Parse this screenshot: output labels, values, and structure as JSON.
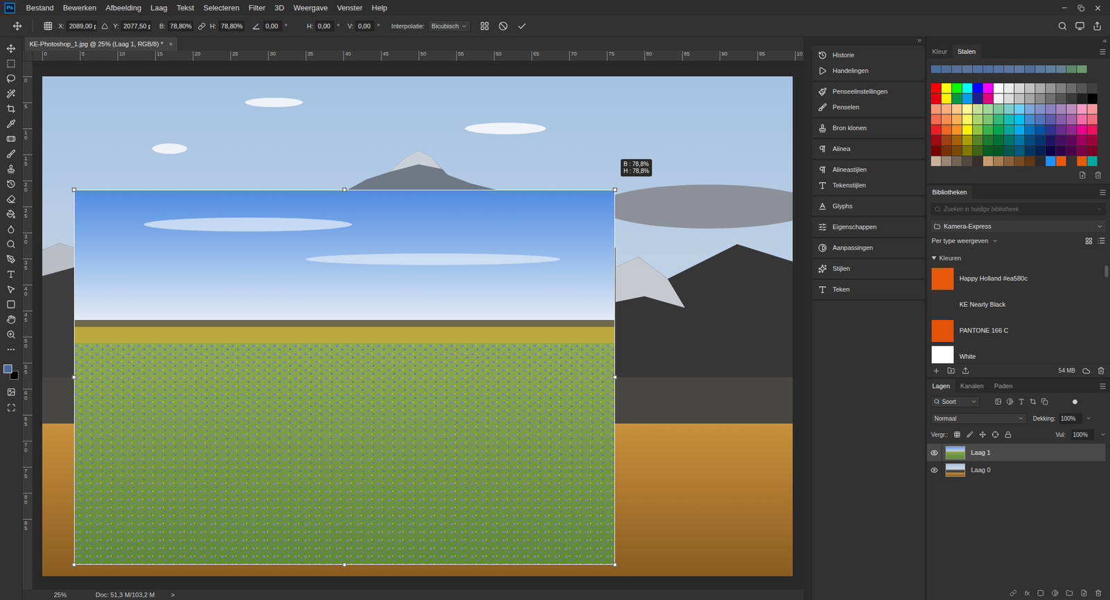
{
  "menu": {
    "logo": "Ps",
    "items": [
      "Bestand",
      "Bewerken",
      "Afbeelding",
      "Laag",
      "Tekst",
      "Selecteren",
      "Filter",
      "3D",
      "Weergave",
      "Venster",
      "Help"
    ]
  },
  "options_bar": {
    "position": [
      {
        "label": "X:",
        "value": "2089,00 p"
      },
      {
        "label": "Y:",
        "value": "2077,50 p"
      }
    ],
    "scale": [
      {
        "label": "B:",
        "value": "78,80%"
      },
      {
        "label": "H:",
        "value": "78,80%"
      }
    ],
    "rotation": {
      "value": "0,00",
      "unit": "°"
    },
    "skew": [
      {
        "label": "H:",
        "value": "0,00",
        "unit": "°"
      },
      {
        "label": "V:",
        "value": "0,00",
        "unit": "°"
      }
    ],
    "interpolation": {
      "label": "Interpolatie:",
      "value": "Bicubisch"
    }
  },
  "document": {
    "tab_title": "KE-Photoshop_1.jpg @ 25% (Laag 1, RGB/8) *",
    "close": "×"
  },
  "rulers": {
    "horizontal": [
      "0",
      "5",
      "10",
      "15",
      "20",
      "25",
      "30",
      "35",
      "40",
      "45",
      "50",
      "55",
      "60",
      "65",
      "70",
      "75",
      "80",
      "85",
      "90",
      "95",
      "10"
    ],
    "vertical": [
      "0",
      "5",
      "10",
      "15",
      "20",
      "25",
      "30",
      "35",
      "40",
      "45",
      "50",
      "55",
      "60",
      "65",
      "70",
      "75",
      "80",
      "85"
    ]
  },
  "canvas": {
    "tooltip": [
      "B : 78,8%",
      "H : 78,8%"
    ]
  },
  "tools": {
    "foreground": "#4a6a9a",
    "background": "#000000"
  },
  "status_bar": {
    "zoom": "25%",
    "doc": "Doc: 51,3 M/103,2 M",
    "arrow": ">"
  },
  "dock": [
    {
      "items": [
        "Historie",
        "Handelingen"
      ]
    },
    {
      "items": [
        "Penseelinstellingen",
        "Penselen"
      ]
    },
    {
      "items": [
        "Bron klonen"
      ]
    },
    {
      "items": [
        "Alinea"
      ]
    },
    {
      "items": [
        "Alineastijlen",
        "Tekenstijlen"
      ]
    },
    {
      "items": [
        "Glyphs"
      ]
    },
    {
      "items": [
        "Eigenschappen"
      ]
    },
    {
      "items": [
        "Aanpassingen"
      ]
    },
    {
      "items": [
        "Stijlen"
      ]
    },
    {
      "items": [
        "Teken"
      ]
    }
  ],
  "swatches": {
    "tabs": [
      {
        "label": "Kleur",
        "selected": false
      },
      {
        "label": "Stalen",
        "selected": true
      }
    ],
    "recent": [
      "#4a6c9b",
      "#4d6d9a",
      "#56709a",
      "#5a759c",
      "#51729f",
      "#4f6fa0",
      "#5273a0",
      "#5876a0",
      "#5c789e",
      "#4e6e9c",
      "#587a9e",
      "#5e7f9f",
      "#647f97",
      "#5a8a6a",
      "#6a9a6a"
    ],
    "grid": [
      [
        "#ff0000",
        "#ffff00",
        "#00ff00",
        "#00ffff",
        "#0000ff",
        "#ff00ff",
        "#ffffff",
        "#ebebeb",
        "#d6d6d6",
        "#c0c0c0",
        "#ababab",
        "#959595",
        "#808080",
        "#6b6b6b",
        "#555555",
        "#404040"
      ],
      [
        "#e60012",
        "#fff100",
        "#009944",
        "#00a0e9",
        "#1d2088",
        "#e4007f",
        "#f2f2f2",
        "#dadada",
        "#bfbfbf",
        "#a5a5a5",
        "#8a8a8a",
        "#707070",
        "#565656",
        "#3b3b3b",
        "#212121",
        "#000000"
      ],
      [
        "#f7977a",
        "#fbad82",
        "#fdc68c",
        "#fff799",
        "#c6df9c",
        "#a4d49d",
        "#81ca9d",
        "#7bcdc9",
        "#6ccff7",
        "#7ca6d8",
        "#8293ca",
        "#8881be",
        "#a286bd",
        "#bc8cbf",
        "#f49bc1",
        "#f5999d"
      ],
      [
        "#f26c4f",
        "#f68e54",
        "#fbaf5a",
        "#fff467",
        "#acd372",
        "#7dc473",
        "#39b778",
        "#16bcb4",
        "#00bff3",
        "#438ccb",
        "#5573b7",
        "#5e5ca7",
        "#855fa8",
        "#a763a9",
        "#ef6ea8",
        "#f16d7e"
      ],
      [
        "#ee1d24",
        "#f16522",
        "#f7941d",
        "#fff100",
        "#8fc63d",
        "#37b44a",
        "#00a650",
        "#00a99e",
        "#00aeef",
        "#0072bc",
        "#0054a5",
        "#2f3192",
        "#652c91",
        "#91278f",
        "#ec008c",
        "#ee105a"
      ],
      [
        "#9d0a0f",
        "#a1410d",
        "#a36209",
        "#aba000",
        "#588528",
        "#197b30",
        "#007236",
        "#00736a",
        "#0076a4",
        "#004a80",
        "#003370",
        "#1d1363",
        "#450e61",
        "#62055f",
        "#9e005c",
        "#9d0039"
      ],
      [
        "#790000",
        "#7b3000",
        "#7c4900",
        "#827a00",
        "#3e6617",
        "#045f20",
        "#005824",
        "#005951",
        "#005b7e",
        "#003562",
        "#002056",
        "#0c004b",
        "#30004a",
        "#4b0048",
        "#7a0045",
        "#7a0026"
      ],
      [
        "#c7b299",
        "#998675",
        "#736357",
        "#534741",
        "#362f2d",
        "#c69c6d",
        "#a77c50",
        "#8c623a",
        "#754c24",
        "#603913",
        "#2b2b2b",
        "#1e90ff",
        "#ea580c",
        "#333333",
        "#ea580c",
        "#00a99e"
      ]
    ]
  },
  "libraries": {
    "tab": "Bibliotheken",
    "search_placeholder": "Zoeken in huidige bibliotheek",
    "library": "Kamera-Express",
    "view": "Per type weergeven",
    "section": {
      "label": "Kleuren",
      "expanded": true
    },
    "colors": [
      {
        "name": "Happy Holland #ea580c",
        "color": "#ea580c"
      },
      {
        "name": "KE Nearly Black",
        "color": "#333333"
      },
      {
        "name": "PANTONE 166 C",
        "color": "#e35205"
      },
      {
        "name": "White",
        "color": "#ffffff"
      }
    ],
    "storage": "54 MB"
  },
  "layers": {
    "tabs": [
      {
        "label": "Lagen",
        "selected": true
      },
      {
        "label": "Kanalen",
        "selected": false
      },
      {
        "label": "Paden",
        "selected": false
      }
    ],
    "filter": "Soort",
    "blend_mode": "Normaal",
    "opacity": {
      "label": "Dekking:",
      "value": "100%"
    },
    "lock_label": "Vergr.:",
    "fill": {
      "label": "Vul:",
      "value": "100%"
    },
    "items": [
      {
        "name": "Laag 1",
        "visible": true,
        "selected": true,
        "kind": "meadow"
      },
      {
        "name": "Laag 0",
        "visible": true,
        "selected": false,
        "kind": "landscape"
      }
    ],
    "footer_fx": "fx"
  }
}
